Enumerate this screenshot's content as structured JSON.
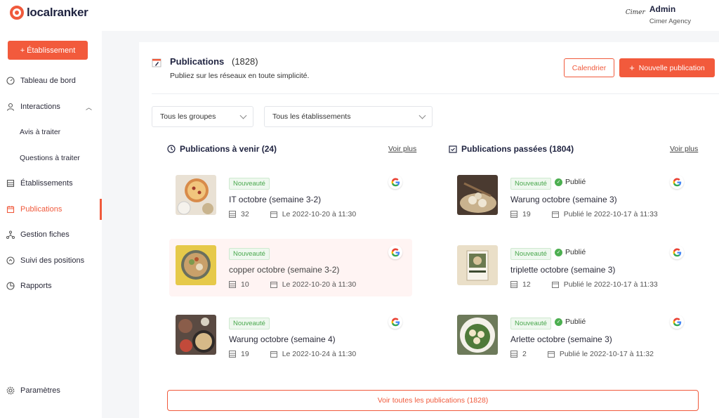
{
  "brand": {
    "name": "localranker",
    "accent": "#f25a3c"
  },
  "user": {
    "name": "Admin",
    "org": "Cimer Agency",
    "logo_text": "Cimer"
  },
  "sidebar": {
    "add_button": "Établissement",
    "items": [
      {
        "label": "Tableau de bord",
        "icon": "dashboard-icon"
      },
      {
        "label": "Interactions",
        "icon": "user-icon"
      },
      {
        "label": "Avis à traiter"
      },
      {
        "label": "Questions à traiter"
      },
      {
        "label": "Établissements",
        "icon": "building-icon"
      },
      {
        "label": "Publications",
        "icon": "calendar-icon",
        "active": true
      },
      {
        "label": "Gestion fiches",
        "icon": "network-icon"
      },
      {
        "label": "Suivi des positions",
        "icon": "target-icon"
      },
      {
        "label": "Rapports",
        "icon": "pie-icon"
      },
      {
        "label": "Paramètres",
        "icon": "gear-icon"
      }
    ]
  },
  "header": {
    "title": "Publications",
    "count": "(1828)",
    "subtitle": "Publiez sur les réseaux en toute simplicité.",
    "calendar_button": "Calendrier",
    "new_button": "Nouvelle publication"
  },
  "filters": {
    "groups": "Tous les groupes",
    "establishments": "Tous les établissements"
  },
  "upcoming": {
    "title": "Publications à venir (24)",
    "more": "Voir plus",
    "items": [
      {
        "badge": "Nouveauté",
        "title": "IT octobre (semaine 3-2)",
        "count": "32",
        "date": "Le 2022-10-20 à 11:30"
      },
      {
        "badge": "Nouveauté",
        "title": "copper octobre (semaine 3-2)",
        "count": "10",
        "date": "Le 2022-10-20 à 11:30"
      },
      {
        "badge": "Nouveauté",
        "title": "Warung octobre (semaine 4)",
        "count": "19",
        "date": "Le 2022-10-24 à 11:30"
      }
    ]
  },
  "past": {
    "title": "Publications passées (1804)",
    "more": "Voir plus",
    "items": [
      {
        "badge": "Nouveauté",
        "status": "Publié",
        "title": "Warung octobre (semaine 3)",
        "count": "19",
        "date": "Publié le 2022-10-17 à 11:33"
      },
      {
        "badge": "Nouveauté",
        "status": "Publié",
        "title": "triplette octobre (semaine 3)",
        "count": "12",
        "date": "Publié le 2022-10-17 à 11:33"
      },
      {
        "badge": "Nouveauté",
        "status": "Publié",
        "title": "Arlette octobre (semaine 3)",
        "count": "2",
        "date": "Publié le 2022-10-17 à 11:32"
      }
    ]
  },
  "all_button": "Voir toutes les publications (1828)"
}
